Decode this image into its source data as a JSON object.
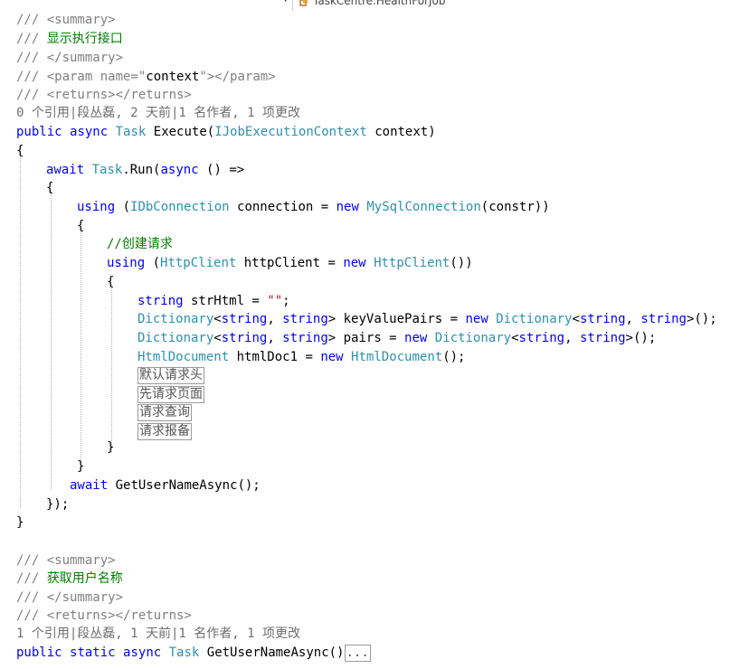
{
  "navbar": {
    "dropdown_arrow": "▾",
    "member_label": "TaskCentre.HealthForJob"
  },
  "code": {
    "l1": "/// <summary>",
    "l2_prefix": "/// ",
    "l2_text": "显示执行接口",
    "l3": "/// </summary>",
    "l4_a": "/// <param name=\"",
    "l4_b": "context",
    "l4_c": "\"></param>",
    "l5": "/// <returns></returns>",
    "lens1": "0 个引用|段丛磊, 2 天前|1 名作者, 1 项更改",
    "l6_public": "public",
    "l6_async": "async",
    "l6_task": "Task",
    "l6_name": "Execute(",
    "l6_type": "IJobExecutionContext",
    "l6_end": " context)",
    "l7": "{",
    "l8_await": "await",
    "l8_task": "Task",
    "l8_run": ".Run(",
    "l8_async": "async",
    "l8_end": " () =>",
    "l9": "{",
    "l10_using": "using",
    "l10_open": " (",
    "l10_type": "IDbConnection",
    "l10_mid": " connection = ",
    "l10_new": "new",
    "l10_type2": "MySqlConnection",
    "l10_end": "(constr))",
    "l11": "{",
    "l12": "//创建请求",
    "l13_using": "using",
    "l13_open": " (",
    "l13_type": "HttpClient",
    "l13_mid": " httpClient = ",
    "l13_new": "new",
    "l13_type2": "HttpClient",
    "l13_end": "())",
    "l14": "{",
    "l15_kw": "string",
    "l15_mid": " strHtml = ",
    "l15_str": "\"\"",
    "l15_end": ";",
    "l16_type": "Dictionary",
    "l16_a": "<",
    "l16_kw1": "string",
    "l16_b": ", ",
    "l16_kw2": "string",
    "l16_c": "> keyValuePairs = ",
    "l16_new": "new",
    "l16_type2": "Dictionary",
    "l16_d": "<",
    "l16_kw3": "string",
    "l16_e": ", ",
    "l16_kw4": "string",
    "l16_f": ">();",
    "l17_type": "Dictionary",
    "l17_a": "<",
    "l17_kw1": "string",
    "l17_b": ", ",
    "l17_kw2": "string",
    "l17_c": "> pairs = ",
    "l17_new": "new",
    "l17_type2": "Dictionary",
    "l17_d": "<",
    "l17_kw3": "string",
    "l17_e": ", ",
    "l17_kw4": "string",
    "l17_f": ">();",
    "l18_type": "HtmlDocument",
    "l18_mid": " htmlDoc1 = ",
    "l18_new": "new",
    "l18_type2": "HtmlDocument",
    "l18_end": "();",
    "region1": "默认请求头",
    "region2": "先请求页面",
    "region3": "请求查询",
    "region4": "请求报备",
    "l23": "}",
    "l24": "}",
    "l25_await": "await",
    "l25_end": " GetUserNameAsync();",
    "l26": "});",
    "l27": "}",
    "l29": "/// <summary>",
    "l30_prefix": "/// ",
    "l30_text": "获取用户名称",
    "l31": "/// </summary>",
    "l32": "/// <returns></returns>",
    "lens2": "1 个引用|段丛磊, 1 天前|1 名作者, 1 项更改",
    "l33_public": "public",
    "l33_static": "static",
    "l33_async": "async",
    "l33_task": "Task",
    "l33_name": " GetUserNameAsync()",
    "l33_collapsed": "..."
  }
}
